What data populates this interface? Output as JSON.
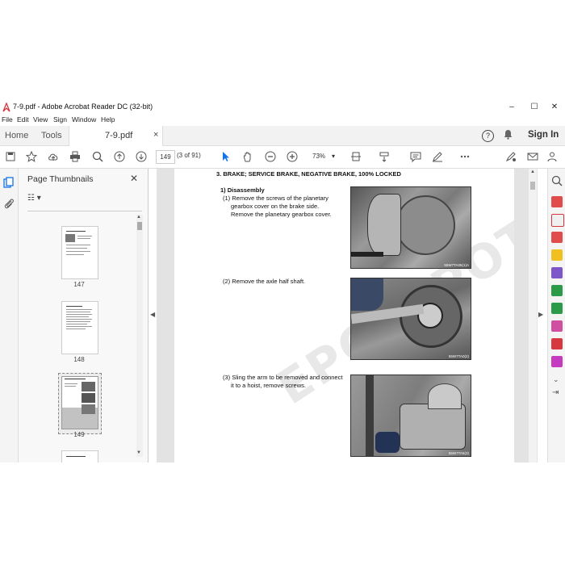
{
  "window": {
    "title": "7-9.pdf - Adobe Acrobat Reader DC (32-bit)",
    "controls": {
      "minimize": "–",
      "maximize": "☐",
      "close": "✕"
    }
  },
  "menu": [
    "File",
    "Edit",
    "View",
    "Sign",
    "Window",
    "Help"
  ],
  "tabs": {
    "home": "Home",
    "tools": "Tools",
    "document": "7-9.pdf",
    "close": "×"
  },
  "header": {
    "help": "?",
    "sign_in": "Sign In"
  },
  "toolbar": {
    "page_number": "149",
    "page_count": "(3 of 91)",
    "zoom": "73%",
    "dropdown": "▾"
  },
  "thumbnails": {
    "title": "Page Thumbnails",
    "close": "✕",
    "options": "☷ ▾",
    "pages": [
      {
        "label": "147",
        "selected": false
      },
      {
        "label": "148",
        "selected": false
      },
      {
        "label": "149",
        "selected": true
      }
    ]
  },
  "document": {
    "heading": "3.  BRAKE; SERVICE BRAKE, NEGATIVE BRAKE, 100% LOCKED",
    "section": "1) Disassembly",
    "steps": [
      {
        "line1": "(1)  Remove the screws of the planetary",
        "line2": "gearbox cover on the brake side.",
        "line3": "Remove the planetary gearbox cover.",
        "caption": "55W7TA05(1)A"
      },
      {
        "line1": "(2)  Remove the axle half shaft.",
        "line2": "",
        "line3": "",
        "caption": "55W7TA0(2)"
      },
      {
        "line1": "(3)  Sling the arm to be removed and connect",
        "line2": "it to a hoist, remove screws.",
        "line3": "",
        "caption": "55W7TA5(3)"
      }
    ],
    "watermark": "EPCDEPOT.COM"
  },
  "colors": {
    "acrobat_red": "#d7373f",
    "accent_blue": "#1473e6"
  }
}
